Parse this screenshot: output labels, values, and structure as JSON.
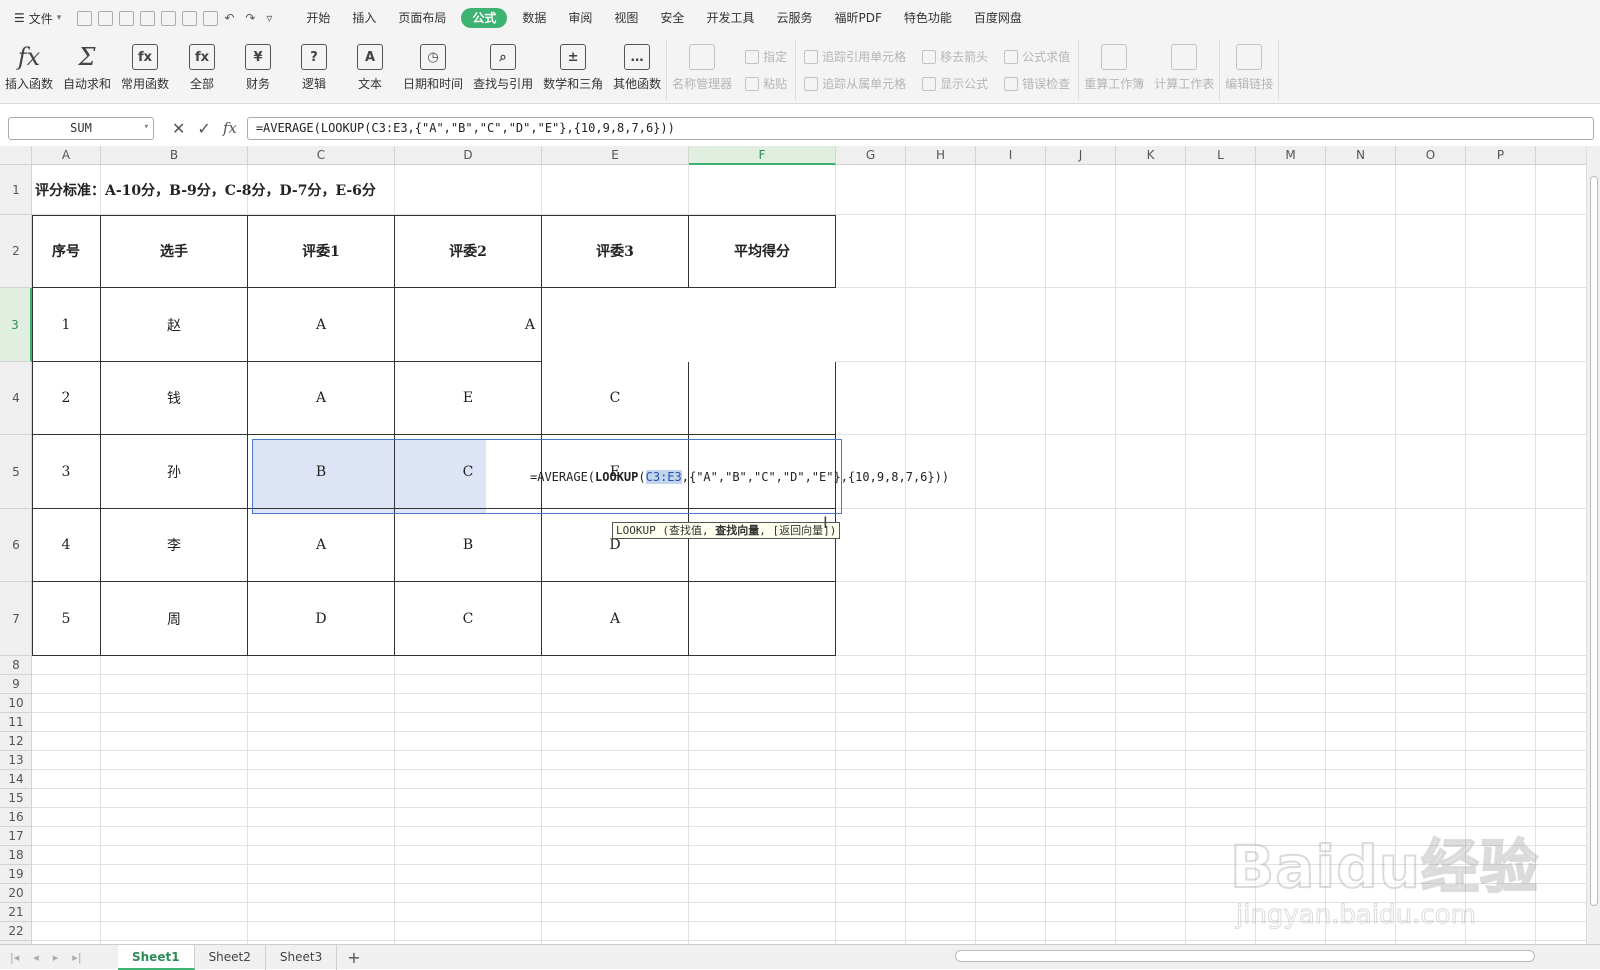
{
  "menu": {
    "file_label": "文件",
    "items": [
      "开始",
      "插入",
      "页面布局",
      "公式",
      "数据",
      "审阅",
      "视图",
      "安全",
      "开发工具",
      "云服务",
      "福昕PDF",
      "特色功能",
      "百度网盘"
    ],
    "active_index": 3
  },
  "ribbon": {
    "buttons": [
      {
        "label": "插入函数",
        "icon": "fx",
        "name": "insert-function-button"
      },
      {
        "label": "自动求和",
        "icon": "Σ",
        "name": "autosum-button"
      },
      {
        "label": "常用函数",
        "icon": "fx",
        "name": "common-functions-button"
      },
      {
        "label": "全部",
        "icon": "fx",
        "name": "all-functions-button"
      },
      {
        "label": "财务",
        "icon": "¥",
        "name": "financial-button"
      },
      {
        "label": "逻辑",
        "icon": "?",
        "name": "logical-button"
      },
      {
        "label": "文本",
        "icon": "A",
        "name": "text-functions-button"
      },
      {
        "label": "日期和时间",
        "icon": "◷",
        "name": "date-time-button"
      },
      {
        "label": "查找与引用",
        "icon": "⌕",
        "name": "lookup-reference-button"
      },
      {
        "label": "数学和三角",
        "icon": "±",
        "name": "math-trig-button"
      },
      {
        "label": "其他函数",
        "icon": "…",
        "name": "other-functions-button"
      }
    ],
    "name_manager": "名称管理器",
    "define": "指定",
    "paste": "粘贴",
    "trace_precedents": "追踪引用单元格",
    "trace_dependents": "追踪从属单元格",
    "remove_arrows": "移去箭头",
    "show_formulas": "显示公式",
    "evaluate": "公式求值",
    "error_check": "错误检查",
    "recalc_workbook": "重算工作簿",
    "calc_sheet": "计算工作表",
    "edit_links": "编辑链接"
  },
  "formula_bar": {
    "name_box": "SUM",
    "formula": "=AVERAGE(LOOKUP(C3:E3,{\"A\",\"B\",\"C\",\"D\",\"E\"},{10,9,8,7,6}))"
  },
  "columns": [
    "A",
    "B",
    "C",
    "D",
    "E",
    "F",
    "G",
    "H",
    "I",
    "J",
    "K",
    "L",
    "M",
    "N",
    "O",
    "P"
  ],
  "rows": [
    "1",
    "2",
    "3",
    "4",
    "5",
    "6",
    "7",
    "8",
    "9",
    "10",
    "11",
    "12",
    "13",
    "14",
    "15",
    "16",
    "17",
    "18",
    "19",
    "20",
    "21",
    "22"
  ],
  "sheet": {
    "title": "评分标准：A-10分，B-9分，C-8分，D-7分，E-6分",
    "headers": [
      "序号",
      "选手",
      "评委1",
      "评委2",
      "评委3",
      "平均得分"
    ],
    "data": [
      [
        "1",
        "赵",
        "A",
        "A",
        "",
        ""
      ],
      [
        "2",
        "钱",
        "A",
        "E",
        "C",
        ""
      ],
      [
        "3",
        "孙",
        "B",
        "C",
        "E",
        ""
      ],
      [
        "4",
        "李",
        "A",
        "B",
        "D",
        ""
      ],
      [
        "5",
        "周",
        "D",
        "C",
        "A",
        ""
      ]
    ]
  },
  "editing": {
    "prefix": "=AVERAGE(",
    "func": "LOOKUP",
    "paren": "(",
    "ref": "C3:E3",
    "suffix": ",{\"A\",\"B\",\"C\",\"D\",\"E\"},{10,9,8,7,6}))",
    "tooltip_func": "LOOKUP",
    "tooltip_open": " (查找值, ",
    "tooltip_bold": "查找向量",
    "tooltip_rest": ", [返回向量])"
  },
  "tabs": [
    "Sheet1",
    "Sheet2",
    "Sheet3"
  ],
  "watermark": {
    "line1": "Baidu经验",
    "line2": "jingyan.baidu.com"
  }
}
